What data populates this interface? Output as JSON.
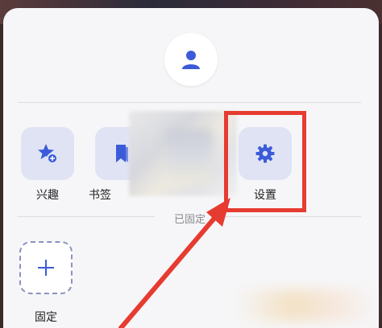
{
  "panel": {
    "pinned_section_label": "已固定"
  },
  "tiles": [
    {
      "label": "兴趣",
      "icon": "star-plus-icon"
    },
    {
      "label": "书签",
      "icon": "bookmark-icon"
    },
    {
      "label": "设置",
      "icon": "gear-icon"
    }
  ],
  "pinned": {
    "add_label": "固定",
    "icon": "plus-icon"
  },
  "avatar": {
    "icon": "user-icon"
  },
  "colors": {
    "accent": "#3b5bd9",
    "tile_bg": "#dfe3f4",
    "highlight": "#e63b31"
  }
}
